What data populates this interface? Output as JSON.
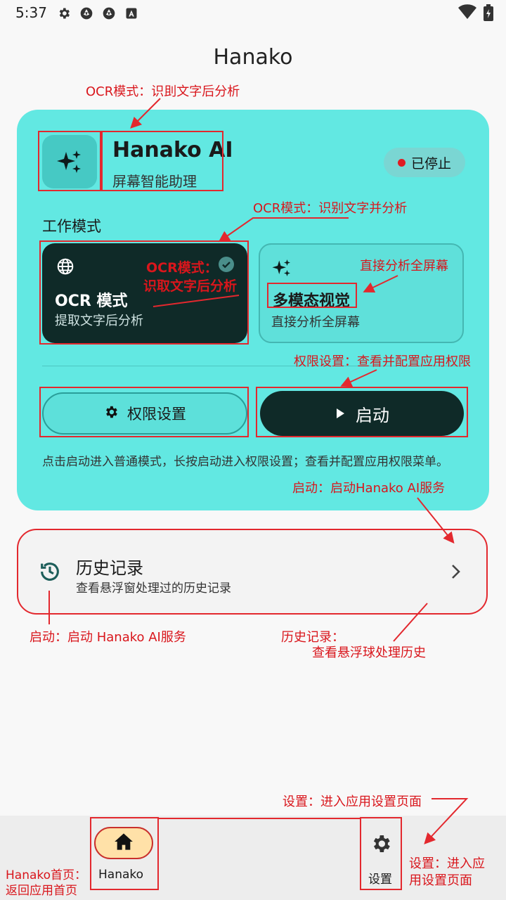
{
  "status_bar": {
    "time": "5:37"
  },
  "app_title": "Hanako",
  "app_card": {
    "name": "Hanako AI",
    "subtitle": "屏幕智能助理",
    "status": "已停止"
  },
  "work_mode": {
    "heading": "工作模式",
    "options": [
      {
        "title": "OCR 模式",
        "desc": "提取文字后分析",
        "selected": true
      },
      {
        "title": "多模态视觉",
        "desc": "直接分析全屏幕",
        "selected": false
      }
    ]
  },
  "buttons": {
    "permissions": "权限设置",
    "start": "启动"
  },
  "hint": "点击启动进入普通模式，长按启动进入权限设置；查看并配置应用权限菜单。",
  "history": {
    "title": "历史记录",
    "subtitle": "查看悬浮窗处理过的历史记录"
  },
  "nav": {
    "home": "Hanako",
    "settings": "设置"
  },
  "annotations": {
    "a1": "OCR模式：识刞文字后分析",
    "a2": "OCR模式：识别文字并分析",
    "a3_line1": "OCR模式：",
    "a3_line2": "识取文字后分析",
    "a4": "直接分析全屏幕",
    "a5": "权限设置：查看并配置应用权限",
    "a6": "启动：启动Hanako AI服务",
    "a7": "启动：启动 Hanako AI服务",
    "a8_line1": "历史记录：",
    "a8_line2": "查看悬浮球处理历史",
    "a9": "设置：进入应用设置页面",
    "a10_line1": "设置：进入应",
    "a10_line2": "用设置页面",
    "a11_line1": "Hanako首页：",
    "a11_line2": "返回应用首页"
  },
  "colors": {
    "card": "#62e8e2",
    "dark": "#0f2a28",
    "annotation": "#e3282e",
    "home_pill": "#ffe1a8"
  }
}
